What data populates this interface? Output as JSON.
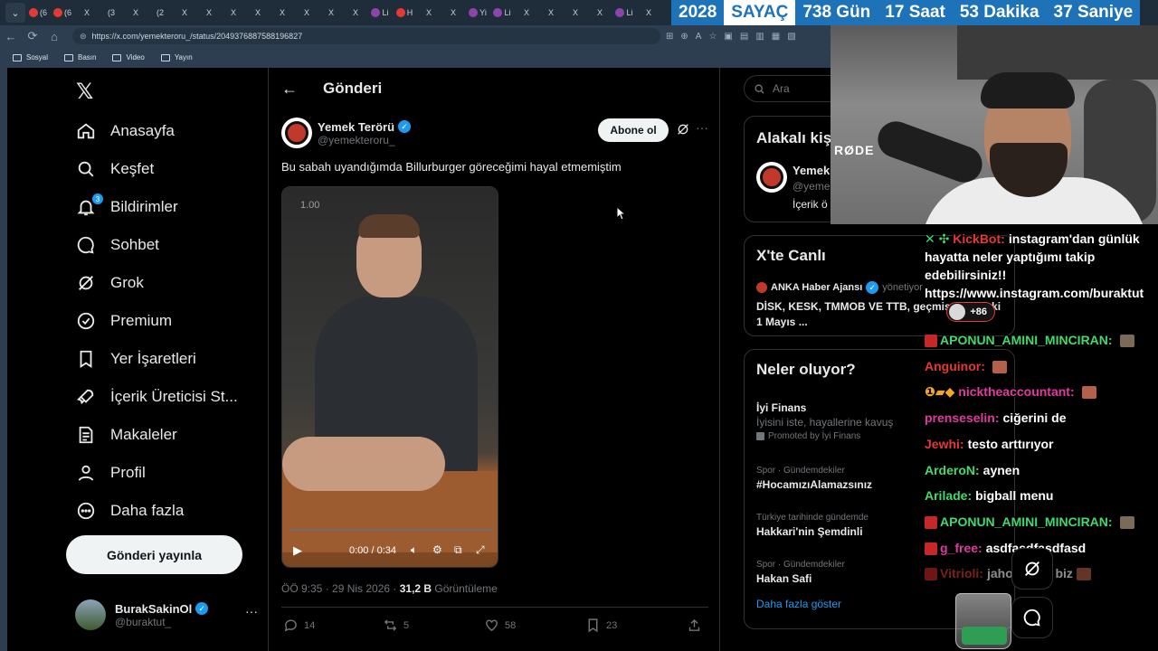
{
  "tabstrip": {
    "chevron": "⌄",
    "tabs": [
      "(6",
      "(6",
      "X",
      "(3",
      "X",
      "(2",
      "X",
      "X",
      "X",
      "X",
      "X",
      "X",
      "X",
      "X",
      "Li",
      "H",
      "X",
      "X",
      "Yi",
      "Li",
      "X",
      "X",
      "X",
      "X",
      "Li",
      "X"
    ]
  },
  "counter": {
    "year": "2028",
    "label": "SAYAÇ",
    "days": "738 Gün",
    "hours": "17 Saat",
    "minutes": "53 Dakika",
    "seconds": "37 Saniye"
  },
  "browser": {
    "url": "https://x.com/yemekteroru_/status/2049376887588196827"
  },
  "bookmarks": [
    "Sosyal",
    "Basın",
    "Video",
    "Yayın"
  ],
  "sidebar": {
    "items": [
      {
        "label": "Anasayfa",
        "icon": "home-icon"
      },
      {
        "label": "Keşfet",
        "icon": "search-icon"
      },
      {
        "label": "Bildirimler",
        "icon": "bell-icon",
        "badge": "3"
      },
      {
        "label": "Sohbet",
        "icon": "chat-icon"
      },
      {
        "label": "Grok",
        "icon": "grok-icon"
      },
      {
        "label": "Premium",
        "icon": "premium-icon"
      },
      {
        "label": "Yer İşaretleri",
        "icon": "bookmark-icon"
      },
      {
        "label": "İçerik Üreticisi St...",
        "icon": "rocket-icon"
      },
      {
        "label": "Makaleler",
        "icon": "article-icon"
      },
      {
        "label": "Profil",
        "icon": "profile-icon"
      },
      {
        "label": "Daha fazla",
        "icon": "more-circle-icon"
      }
    ],
    "post_button": "Gönderi yayınla",
    "me": {
      "name": "BurakSakinOl",
      "handle": "@buraktut_",
      "more": "···"
    }
  },
  "main": {
    "title": "Gönderi",
    "author": {
      "name": "Yemek Terörü",
      "handle": "@yemekteroru_"
    },
    "subscribe": "Abone ol",
    "more": "···",
    "text": "Bu sabah uyandığımda Billurburger göreceğimi hayal etmemiştim",
    "video": {
      "overlay_number": "1.00",
      "time": "0:00 / 0:34"
    },
    "meta": {
      "time": "ÖÖ 9:35 · 29 Nis 2026 · ",
      "views": "31,2 B",
      "views_label": " Görüntüleme"
    },
    "actions": {
      "replies": "14",
      "reposts": "5",
      "likes": "58",
      "bookmarks": "23"
    }
  },
  "right": {
    "search_placeholder": "Ara",
    "related": {
      "title": "Alakalı kiş",
      "name": "Yemek",
      "handle": "@yeme",
      "bio": "İçerik ö"
    },
    "live": {
      "title": "X'te Canlı",
      "source": "ANKA Haber Ajansı",
      "role": "yönetiyor",
      "text": "DİSK, KESK, TMMOB VE TTB, geçmiş yıllardaki 1 Mayıs ..."
    },
    "trends": {
      "title": "Neler oluyor?",
      "items": [
        {
          "category": "",
          "name": "İyi Finans",
          "sub": "İyisini iste, hayallerine kavuş",
          "promo": "Promoted by İyi Finans"
        },
        {
          "category": "Spor · Gündemdekiler",
          "name": "#HocamızıAlamazsınız"
        },
        {
          "category": "Türkiye tarihinde gündemde",
          "name": "Hakkari'nin Şemdinli"
        },
        {
          "category": "Spor · Gündemdekiler",
          "name": "Hakan Safi"
        }
      ],
      "show_more": "Daha fazla göster"
    }
  },
  "webcam": {
    "mic_brand": "RØDE"
  },
  "chat": {
    "plus_pill": "+86",
    "lines": [
      {
        "user": "KickBot:",
        "text": "instagram'dan günlük hayatta neler yaptığımı takip edebilirsiniz!! https://www.instagram.com/buraktut",
        "color": "#e53935"
      },
      {
        "user": "APONUN_AMINI_MINCIRAN:",
        "text": "",
        "color": "#43d96b"
      },
      {
        "user": "Anguinor:",
        "text": "",
        "color": "#e53935"
      },
      {
        "user": "nicktheaccountant:",
        "text": "",
        "color": "#e03aa0"
      },
      {
        "user": "prenseselin:",
        "text": "ciğerini de",
        "color": "#e03aa0"
      },
      {
        "user": "Jewhi:",
        "text": "testo arttırıyor",
        "color": "#e53935"
      },
      {
        "user": "ArderoN:",
        "text": "aynen",
        "color": "#43d96b"
      },
      {
        "user": "Arilade:",
        "text": "bigball menu",
        "color": "#43d96b"
      },
      {
        "user": "APONUN_AMINI_MINCIRAN:",
        "text": "",
        "color": "#43d96b"
      },
      {
        "user": "g_free:",
        "text": "asdfasdfasdfasd",
        "color": "#e03aa0"
      },
      {
        "user": "Vitrioli:",
        "text": "jaho ayyuz biz",
        "color": "#e53935"
      }
    ]
  },
  "colors": {
    "accent": "#1d9bf0",
    "counter_blue": "#1e73b8",
    "bg": "#000000",
    "border": "#2f3336"
  }
}
